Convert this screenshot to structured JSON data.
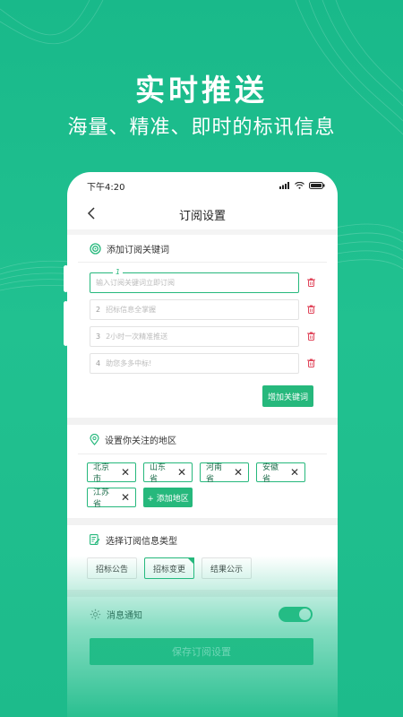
{
  "promo": {
    "title": "实时推送",
    "subtitle": "海量、精准、即时的标讯信息"
  },
  "status_bar": {
    "time": "下午4:20"
  },
  "navbar": {
    "title": "订阅设置",
    "back_icon": "chevron-left-icon"
  },
  "keywords": {
    "header": "添加订阅关键词",
    "active_index": "1",
    "items": [
      {
        "num": "",
        "placeholder": "输入订阅关键词立即订阅"
      },
      {
        "num": "2",
        "placeholder": "招标信息全掌握"
      },
      {
        "num": "3",
        "placeholder": "2小时一次精准推送"
      },
      {
        "num": "4",
        "placeholder": "助您多多中标!"
      }
    ],
    "add_button": "增加关键词"
  },
  "regions": {
    "header": "设置你关注的地区",
    "items": [
      "北京市",
      "山东省",
      "河南省",
      "安徽省",
      "江苏省"
    ],
    "add_button": "+ 添加地区"
  },
  "types": {
    "header": "选择订阅信息类型",
    "items": [
      "招标公告",
      "招标变更",
      "结果公示"
    ],
    "selected": "招标变更"
  },
  "notify": {
    "label": "消息通知",
    "enabled": true
  },
  "save_button": "保存订阅设置",
  "colors": {
    "accent": "#26b87c",
    "background": "#1fbd8c",
    "delete": "#e0455a"
  }
}
